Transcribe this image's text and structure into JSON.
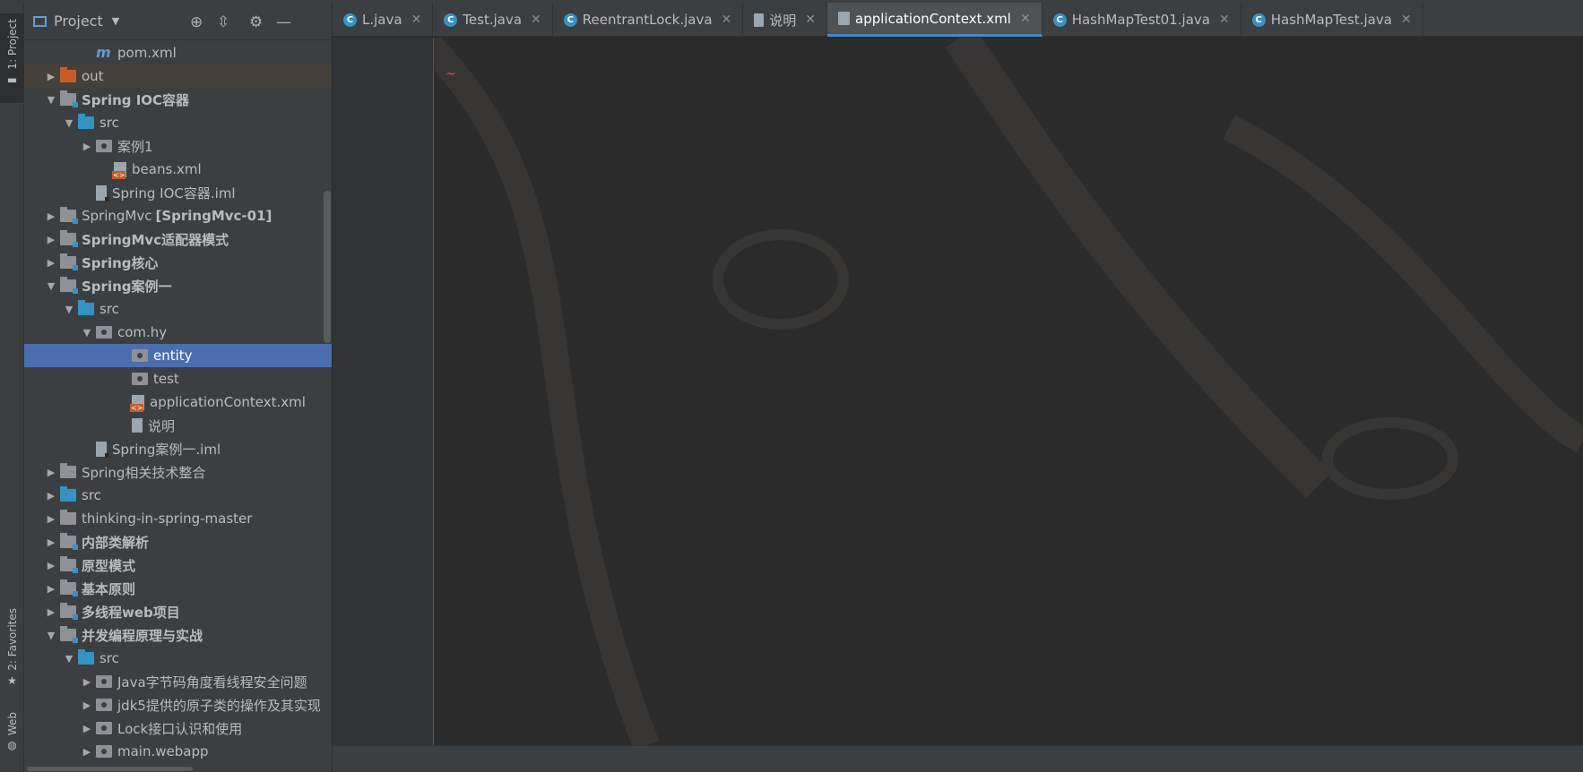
{
  "left_strip": {
    "project_tab": "1: Project",
    "favorites_tab": "2: Favorites",
    "web_tab": "Web"
  },
  "panel": {
    "title": "Project",
    "icons": [
      "locate-icon",
      "collapse-all-icon",
      "gear-icon",
      "hide-icon"
    ]
  },
  "tree": [
    {
      "label": "pom.xml",
      "type": "maven",
      "depth": 3,
      "arrow": ""
    },
    {
      "label": "out",
      "type": "folder-orange",
      "depth": 1,
      "arrow": "▶"
    },
    {
      "label": "Spring IOC容器",
      "type": "module",
      "depth": 1,
      "arrow": "▼",
      "bold": true
    },
    {
      "label": "src",
      "type": "folder-blue",
      "depth": 2,
      "arrow": "▼"
    },
    {
      "label": "案例1",
      "type": "pkg",
      "depth": 3,
      "arrow": "▶"
    },
    {
      "label": "beans.xml",
      "type": "xml",
      "depth": 4,
      "arrow": ""
    },
    {
      "label": "Spring IOC容器.iml",
      "type": "iml",
      "depth": 3,
      "arrow": ""
    },
    {
      "label": "SpringMvc",
      "suffix": "[SpringMvc-01]",
      "type": "module",
      "depth": 1,
      "arrow": "▶"
    },
    {
      "label": "SpringMvc适配器模式",
      "type": "module",
      "depth": 1,
      "arrow": "▶",
      "bold": true
    },
    {
      "label": "Spring核心",
      "type": "module",
      "depth": 1,
      "arrow": "▶",
      "bold": true
    },
    {
      "label": "Spring案例一",
      "type": "module",
      "depth": 1,
      "arrow": "▼",
      "bold": true
    },
    {
      "label": "src",
      "type": "folder-blue",
      "depth": 2,
      "arrow": "▼"
    },
    {
      "label": "com.hy",
      "type": "pkg",
      "depth": 3,
      "arrow": "▼"
    },
    {
      "label": "entity",
      "type": "pkg",
      "depth": 5,
      "arrow": "",
      "selected": true
    },
    {
      "label": "test",
      "type": "pkg",
      "depth": 5,
      "arrow": ""
    },
    {
      "label": "applicationContext.xml",
      "type": "xml",
      "depth": 5,
      "arrow": ""
    },
    {
      "label": "说明",
      "type": "text",
      "depth": 5,
      "arrow": ""
    },
    {
      "label": "Spring案例一.iml",
      "type": "iml",
      "depth": 3,
      "arrow": ""
    },
    {
      "label": "Spring相关技术整合",
      "type": "folder-gray",
      "depth": 1,
      "arrow": "▶"
    },
    {
      "label": "src",
      "type": "folder-blue",
      "depth": 1,
      "arrow": "▶"
    },
    {
      "label": "thinking-in-spring-master",
      "type": "folder-gray",
      "depth": 1,
      "arrow": "▶"
    },
    {
      "label": "内部类解析",
      "type": "module",
      "depth": 1,
      "arrow": "▶",
      "bold": true
    },
    {
      "label": "原型模式",
      "type": "module",
      "depth": 1,
      "arrow": "▶",
      "bold": true
    },
    {
      "label": "基本原则",
      "type": "module",
      "depth": 1,
      "arrow": "▶",
      "bold": true
    },
    {
      "label": "多线程web项目",
      "type": "module",
      "depth": 1,
      "arrow": "▶",
      "bold": true
    },
    {
      "label": "并发编程原理与实战",
      "type": "module",
      "depth": 1,
      "arrow": "▼",
      "bold": true
    },
    {
      "label": "src",
      "type": "folder-blue",
      "depth": 2,
      "arrow": "▼"
    },
    {
      "label": "Java字节码角度看线程安全问题",
      "type": "pkg",
      "depth": 3,
      "arrow": "▶"
    },
    {
      "label": "jdk5提供的原子类的操作及其实现",
      "type": "pkg",
      "depth": 3,
      "arrow": "▶"
    },
    {
      "label": "Lock接口认识和使用",
      "type": "pkg",
      "depth": 3,
      "arrow": "▶"
    },
    {
      "label": "main.webapp",
      "type": "pkg",
      "depth": 3,
      "arrow": "▶"
    }
  ],
  "tabs": [
    {
      "label": "L.java",
      "icon": "C",
      "active": false
    },
    {
      "label": "Test.java",
      "icon": "C",
      "active": false
    },
    {
      "label": "ReentrantLock.java",
      "icon": "C",
      "active": false
    },
    {
      "label": "说明",
      "icon": "doc",
      "active": false
    },
    {
      "label": "applicationContext.xml",
      "icon": "xml",
      "active": true
    },
    {
      "label": "HashMapTest01.java",
      "icon": "C",
      "active": false
    },
    {
      "label": "HashMapTest.java",
      "icon": "C",
      "active": false
    }
  ],
  "editor": {
    "squiggle": "~"
  },
  "colors": {
    "selection": "#4b6eaf",
    "tab_active_underline": "#4a88c7",
    "error": "#e05555"
  }
}
